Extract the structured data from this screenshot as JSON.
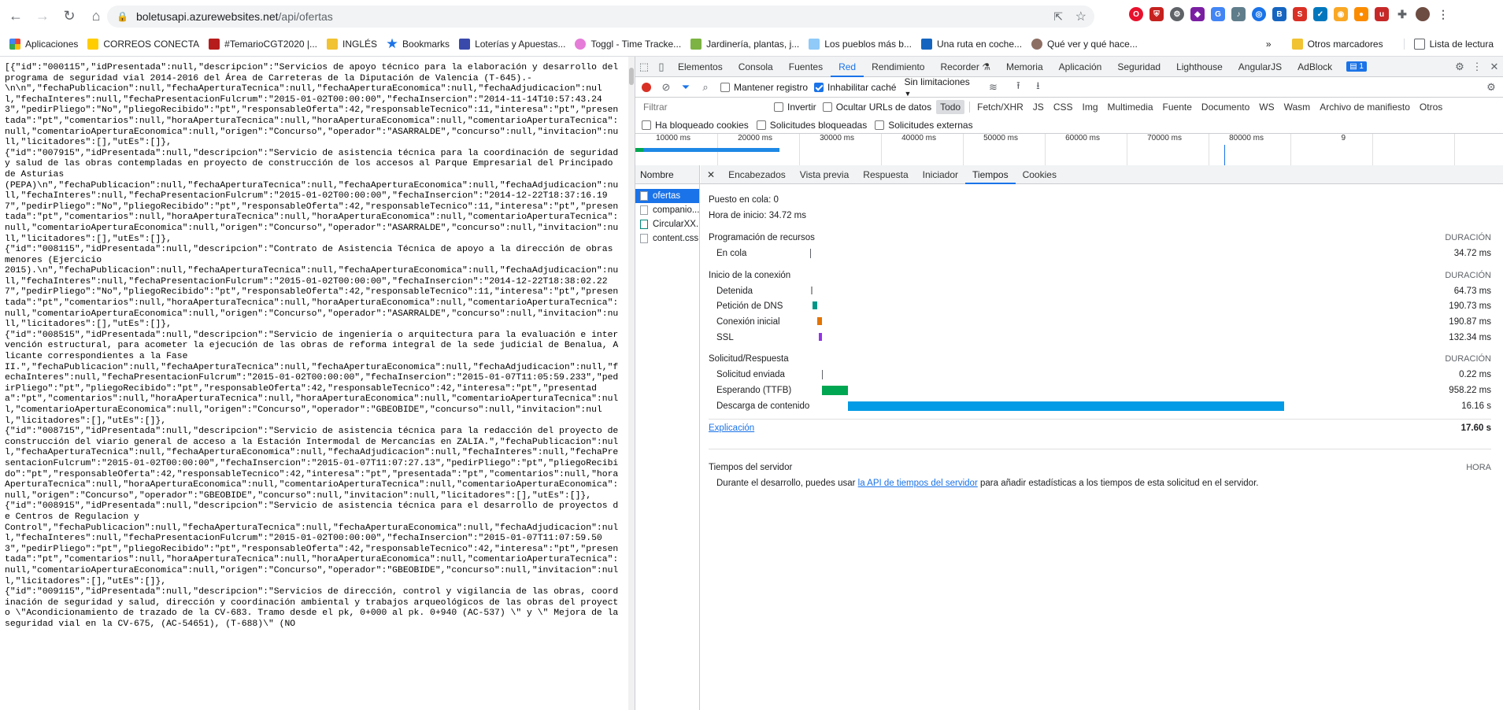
{
  "browser": {
    "url_domain": "boletusapi.azurewebsites.net",
    "url_path": "/api/ofertas"
  },
  "bookmarks": {
    "items": [
      "Aplicaciones",
      "CORREOS CONECTA",
      "#TemarioCGT2020 |...",
      "INGLÉS",
      "Bookmarks",
      "Loterías y Apuestas...",
      "Toggl - Time Tracke...",
      "Jardinería, plantas, j...",
      "Los pueblos más b...",
      "Una ruta en coche...",
      "Qué ver y qué hace..."
    ],
    "more": "»",
    "others": "Otros marcadores",
    "reading": "Lista de lectura"
  },
  "page": {
    "json": "[{\"id\":\"000115\",\"idPresentada\":null,\"descripcion\":\"Servicios de apoyo técnico para la elaboración y desarrollo del programa de seguridad vial 2014-2016 del Área de Carreteras de la Diputación de Valencia (T-645).-\n\\n\\n\",\"fechaPublicacion\":null,\"fechaAperturaTecnica\":null,\"fechaAperturaEconomica\":null,\"fechaAdjudicacion\":null,\"fechaInteres\":null,\"fechaPresentacionFulcrum\":\"2015-01-02T00:00:00\",\"fechaInsercion\":\"2014-11-14T10:57:43.243\",\"pedirPliego\":\"No\",\"pliegoRecibido\":\"pt\",\"responsableOferta\":42,\"responsableTecnico\":11,\"interesa\":\"pt\",\"presentada\":\"pt\",\"comentarios\":null,\"horaAperturaTecnica\":null,\"horaAperturaEconomica\":null,\"comentarioAperturaTecnica\":null,\"comentarioAperturaEconomica\":null,\"origen\":\"Concurso\",\"operador\":\"ASARRALDE\",\"concurso\":null,\"invitacion\":null,\"licitadores\":[],\"utEs\":[]},\n{\"id\":\"007915\",\"idPresentada\":null,\"descripcion\":\"Servicio de asistencia técnica para la coordinación de seguridad y salud de las obras contempladas en proyecto de construcción de los accesos al Parque Empresarial del Principado de Asturias\n(PEPA)\\n\",\"fechaPublicacion\":null,\"fechaAperturaTecnica\":null,\"fechaAperturaEconomica\":null,\"fechaAdjudicacion\":null,\"fechaInteres\":null,\"fechaPresentacionFulcrum\":\"2015-01-02T00:00:00\",\"fechaInsercion\":\"2014-12-22T18:37:16.197\",\"pedirPliego\":\"No\",\"pliegoRecibido\":\"pt\",\"responsableOferta\":42,\"responsableTecnico\":11,\"interesa\":\"pt\",\"presentada\":\"pt\",\"comentarios\":null,\"horaAperturaTecnica\":null,\"horaAperturaEconomica\":null,\"comentarioAperturaTecnica\":null,\"comentarioAperturaEconomica\":null,\"origen\":\"Concurso\",\"operador\":\"ASARRALDE\",\"concurso\":null,\"invitacion\":null,\"licitadores\":[],\"utEs\":[]},\n{\"id\":\"008115\",\"idPresentada\":null,\"descripcion\":\"Contrato de Asistencia Técnica de apoyo a la dirección de obras menores (Ejercicio\n2015).\\n\",\"fechaPublicacion\":null,\"fechaAperturaTecnica\":null,\"fechaAperturaEconomica\":null,\"fechaAdjudicacion\":null,\"fechaInteres\":null,\"fechaPresentacionFulcrum\":\"2015-01-02T00:00:00\",\"fechaInsercion\":\"2014-12-22T18:38:02.227\",\"pedirPliego\":\"No\",\"pliegoRecibido\":\"pt\",\"responsableOferta\":42,\"responsableTecnico\":11,\"interesa\":\"pt\",\"presentada\":\"pt\",\"comentarios\":null,\"horaAperturaTecnica\":null,\"horaAperturaEconomica\":null,\"comentarioAperturaTecnica\":null,\"comentarioAperturaEconomica\":null,\"origen\":\"Concurso\",\"operador\":\"ASARRALDE\",\"concurso\":null,\"invitacion\":null,\"licitadores\":[],\"utEs\":[]},\n{\"id\":\"008515\",\"idPresentada\":null,\"descripcion\":\"Servicio de ingeniería o arquitectura para la evaluación e intervención estructural, para acometer la ejecución de las obras de reforma integral de la sede judicial de Benalua, Alicante correspondientes a la Fase\nII.\",\"fechaPublicacion\":null,\"fechaAperturaTecnica\":null,\"fechaAperturaEconomica\":null,\"fechaAdjudicacion\":null,\"fechaInteres\":null,\"fechaPresentacionFulcrum\":\"2015-01-02T00:00:00\",\"fechaInsercion\":\"2015-01-07T11:05:59.233\",\"pedirPliego\":\"pt\",\"pliegoRecibido\":\"pt\",\"responsableOferta\":42,\"responsableTecnico\":42,\"interesa\":\"pt\",\"presentada\":\"pt\",\"comentarios\":null,\"horaAperturaTecnica\":null,\"horaAperturaEconomica\":null,\"comentarioAperturaTecnica\":null,\"comentarioAperturaEconomica\":null,\"origen\":\"Concurso\",\"operador\":\"GBEOBIDE\",\"concurso\":null,\"invitacion\":null,\"licitadores\":[],\"utEs\":[]},\n{\"id\":\"008715\",\"idPresentada\":null,\"descripcion\":\"Servicio de asistencia técnica para la redacción del proyecto de construcción del viario general de acceso a la Estación Intermodal de Mercancías en ZALIA.\",\"fechaPublicacion\":null,\"fechaAperturaTecnica\":null,\"fechaAperturaEconomica\":null,\"fechaAdjudicacion\":null,\"fechaInteres\":null,\"fechaPresentacionFulcrum\":\"2015-01-02T00:00:00\",\"fechaInsercion\":\"2015-01-07T11:07:27.13\",\"pedirPliego\":\"pt\",\"pliegoRecibido\":\"pt\",\"responsableOferta\":42,\"responsableTecnico\":42,\"interesa\":\"pt\",\"presentada\":\"pt\",\"comentarios\":null,\"horaAperturaTecnica\":null,\"horaAperturaEconomica\":null,\"comentarioAperturaTecnica\":null,\"comentarioAperturaEconomica\":null,\"origen\":\"Concurso\",\"operador\":\"GBEOBIDE\",\"concurso\":null,\"invitacion\":null,\"licitadores\":[],\"utEs\":[]},\n{\"id\":\"008915\",\"idPresentada\":null,\"descripcion\":\"Servicio de asistencia técnica para el desarrollo de proyectos de Centros de Regulacion y\nControl\",\"fechaPublicacion\":null,\"fechaAperturaTecnica\":null,\"fechaAperturaEconomica\":null,\"fechaAdjudicacion\":null,\"fechaInteres\":null,\"fechaPresentacionFulcrum\":\"2015-01-02T00:00:00\",\"fechaInsercion\":\"2015-01-07T11:07:59.503\",\"pedirPliego\":\"pt\",\"pliegoRecibido\":\"pt\",\"responsableOferta\":42,\"responsableTecnico\":42,\"interesa\":\"pt\",\"presentada\":\"pt\",\"comentarios\":null,\"horaAperturaTecnica\":null,\"horaAperturaEconomica\":null,\"comentarioAperturaTecnica\":null,\"comentarioAperturaEconomica\":null,\"origen\":\"Concurso\",\"operador\":\"GBEOBIDE\",\"concurso\":null,\"invitacion\":null,\"licitadores\":[],\"utEs\":[]},\n{\"id\":\"009115\",\"idPresentada\":null,\"descripcion\":\"Servicios de dirección, control y vigilancia de las obras, coordinación de seguridad y salud, dirección y coordinación ambiental y trabajos arqueológicos de las obras del proyecto \\\"Acondicionamiento de trazado de la CV-683. Tramo desde el pk, 0+000 al pk. 0+940 (AC-537) \\\" y \\\" Mejora de la seguridad vial en la CV-675, (AC-54651), (T-688)\\\" (NO"
  },
  "devtools": {
    "tabs": [
      "Elementos",
      "Consola",
      "Fuentes",
      "Red",
      "Rendimiento",
      "Recorder",
      "Memoria",
      "Aplicación",
      "Seguridad",
      "Lighthouse",
      "AngularJS",
      "AdBlock"
    ],
    "active_tab": "Red",
    "badge": "1",
    "toolbar": {
      "preserve_log": "Mantener registro",
      "disable_cache": "Inhabilitar caché",
      "throttle": "Sin limitaciones"
    },
    "filter": {
      "placeholder": "Filtrar",
      "invert": "Invertir",
      "hide_data_urls": "Ocultar URLs de datos",
      "types": [
        "Todo",
        "Fetch/XHR",
        "JS",
        "CSS",
        "Img",
        "Multimedia",
        "Fuente",
        "Documento",
        "WS",
        "Wasm",
        "Archivo de manifiesto",
        "Otros"
      ],
      "active_type": "Todo",
      "blocked_cookies": "Ha bloqueado cookies",
      "blocked_requests": "Solicitudes bloqueadas",
      "third_party": "Solicitudes externas"
    },
    "overview_ticks": [
      "10000 ms",
      "20000 ms",
      "30000 ms",
      "40000 ms",
      "50000 ms",
      "60000 ms",
      "70000 ms",
      "80000 ms",
      "9"
    ],
    "requests_header": "Nombre",
    "requests": [
      "ofertas",
      "companio...",
      "CircularXX...",
      "content.css"
    ],
    "detail_tabs": [
      "Encabezados",
      "Vista previa",
      "Respuesta",
      "Iniciador",
      "Tiempos",
      "Cookies"
    ],
    "active_detail_tab": "Tiempos",
    "timing": {
      "queued_at": "Puesto en cola: 0",
      "started_at": "Hora de inicio: 34.72 ms",
      "sections": [
        {
          "title": "Programación de recursos",
          "dur": "DURACIÓN",
          "rows": [
            {
              "label": "En cola",
              "value": "34.72 ms"
            }
          ]
        },
        {
          "title": "Inicio de la conexión",
          "dur": "DURACIÓN",
          "rows": [
            {
              "label": "Detenida",
              "value": "64.73 ms"
            },
            {
              "label": "Petición de DNS",
              "value": "190.73 ms"
            },
            {
              "label": "Conexión inicial",
              "value": "190.87 ms"
            },
            {
              "label": "SSL",
              "value": "132.34 ms"
            }
          ]
        },
        {
          "title": "Solicitud/Respuesta",
          "dur": "DURACIÓN",
          "rows": [
            {
              "label": "Solicitud enviada",
              "value": "0.22 ms"
            },
            {
              "label": "Esperando (TTFB)",
              "value": "958.22 ms"
            },
            {
              "label": "Descarga de contenido",
              "value": "16.16 s"
            }
          ]
        }
      ],
      "explanation": "Explicación",
      "total": "17.60 s",
      "server_title": "Tiempos del servidor",
      "server_col": "HORA",
      "server_text_before": "Durante el desarrollo, puedes usar ",
      "server_link": "la API de tiempos del servidor",
      "server_text_after": " para añadir estadísticas a los tiempos de esta solicitud en el servidor."
    },
    "colors": {
      "accent": "#1a73e8",
      "dns": "#009688",
      "connect": "#e37400",
      "ssl": "#9334e6",
      "ttfb": "#00a651",
      "download": "#039be5"
    }
  }
}
